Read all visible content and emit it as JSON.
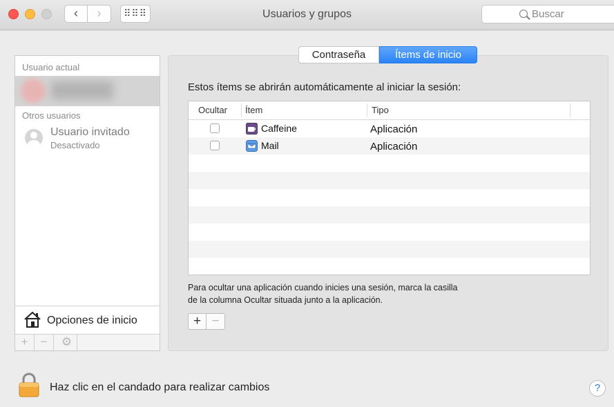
{
  "window": {
    "title": "Usuarios y grupos",
    "search_placeholder": "Buscar",
    "grid_glyph": "⠿⠿⠿",
    "back_glyph": "‹",
    "forward_glyph": "›"
  },
  "sidebar": {
    "current_user_header": "Usuario actual",
    "other_users_header": "Otros usuarios",
    "guest": {
      "name": "Usuario invitado",
      "status": "Desactivado"
    },
    "login_options_label": "Opciones de inicio",
    "add_glyph": "+",
    "remove_glyph": "−",
    "gear_glyph": "⚙"
  },
  "tabs": [
    {
      "label": "Contraseña",
      "selected": false
    },
    {
      "label": "Ítems de inicio",
      "selected": true
    }
  ],
  "main": {
    "intro": "Estos ítems se abrirán automáticamente al iniciar la sesión:",
    "columns": {
      "hide": "Ocultar",
      "item": "Ítem",
      "type": "Tipo"
    },
    "rows": [
      {
        "hide": false,
        "name": "Caffeine",
        "type": "Aplicación",
        "icon": "caffeine-app-icon"
      },
      {
        "hide": false,
        "name": "Mail",
        "type": "Aplicación",
        "icon": "mail-app-icon"
      }
    ],
    "help_line1": "Para ocultar una aplicación cuando inicies una sesión, marca la casilla",
    "help_line2": "de la columna Ocultar situada junto a la aplicación.",
    "add_glyph": "+",
    "remove_glyph": "−"
  },
  "footer": {
    "lock_text": "Haz clic en el candado para realizar cambios",
    "help_glyph": "?"
  },
  "colors": {
    "accent": "#2a83f5",
    "window_bg": "#ececec"
  }
}
